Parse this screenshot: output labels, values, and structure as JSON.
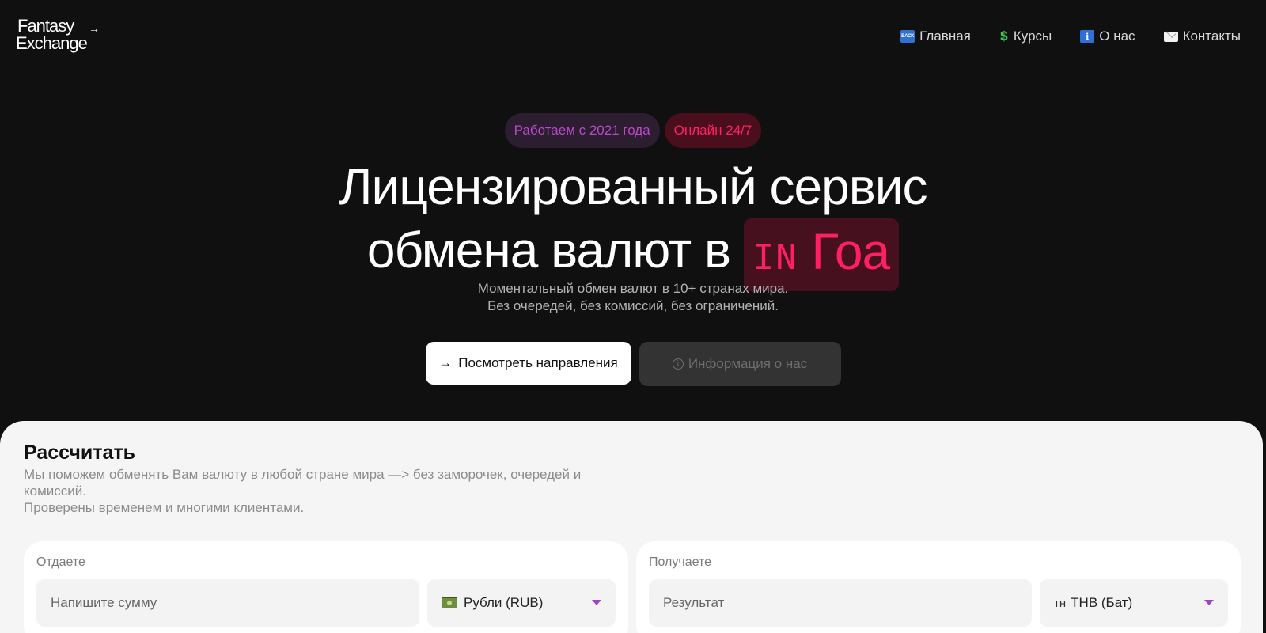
{
  "logo": {
    "line1": "Fantasy",
    "line2": "Exchange",
    "arrow": "→"
  },
  "nav": {
    "items": [
      {
        "icon": "back-icon",
        "icon_text": "BACK",
        "label": "Главная"
      },
      {
        "icon": "dollar-icon",
        "icon_text": "$",
        "label": "Курсы"
      },
      {
        "icon": "info-icon",
        "icon_text": "i",
        "label": "О нас"
      },
      {
        "icon": "mail-icon",
        "icon_text": "",
        "label": "Контакты"
      }
    ]
  },
  "hero": {
    "badges": [
      "Работаем с 2021 года",
      "Онлайн 24/7"
    ],
    "title_line1": "Лицензированный сервис",
    "title_line2_prefix": "обмена валют в",
    "highlight_code": "IN",
    "highlight_city": "Гоа",
    "subtitle_line1": "Моментальный обмен валют в 10+ странах мира.",
    "subtitle_line2": "Без очередей, без комиссий, без ограничений.",
    "primary_button": {
      "icon": "→",
      "label": "Посмотреть направления"
    },
    "secondary_button": {
      "icon": "i",
      "label": "Информация о нас"
    }
  },
  "calculator": {
    "title": "Рассчитать",
    "desc_line1": "Мы поможем обменять Вам валюту в любой стране мира —> без заморочек, очередей и",
    "desc_line2": "комиссий.",
    "desc_line3": "Проверены временем и многими клиентами.",
    "give": {
      "label": "Отдаете",
      "placeholder": "Напишите сумму",
      "currency": "Рубли (RUB)"
    },
    "receive": {
      "label": "Получаете",
      "placeholder": "Результат",
      "currency_prefix": "тн",
      "currency": "THB (Бат)"
    }
  },
  "colors": {
    "background": "#111011",
    "accent_pink": "#ff1f63",
    "accent_purple": "#b84ac8",
    "panel": "#f5f5f5"
  }
}
